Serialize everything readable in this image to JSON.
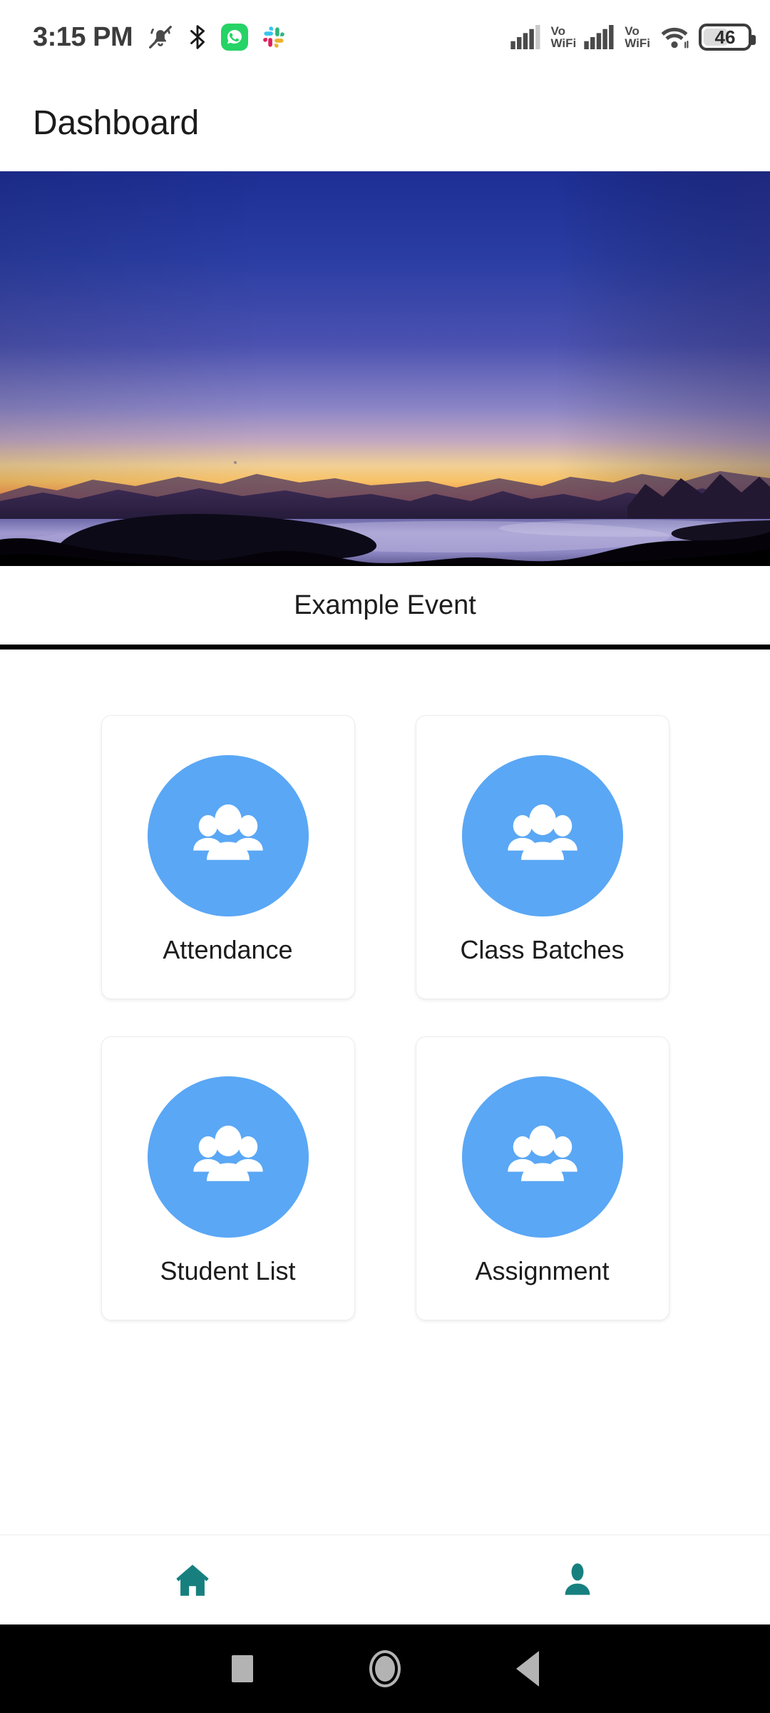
{
  "statusbar": {
    "time": "3:15 PM",
    "icons": [
      "silent-bell-icon",
      "bluetooth-icon",
      "whatsapp-icon",
      "slack-icon"
    ],
    "signal1_label_top": "Vo",
    "signal1_label_bottom": "WiFi",
    "signal2_label_top": "Vo",
    "signal2_label_bottom": "WiFi",
    "wifi": "wifi-icon",
    "battery_percent": "46"
  },
  "appbar": {
    "title": "Dashboard"
  },
  "banner": {
    "alt": "sunset-lake-landscape",
    "sky_top_color": "#1f2f96",
    "sky_mid_color": "#8f8fd0",
    "horizon_glow_color": "#f9c56a",
    "horizon_red_color": "#f2603c",
    "water_color": "#8b85c4",
    "land_color": "#0a0712"
  },
  "event": {
    "caption": "Example Event"
  },
  "tiles": [
    {
      "label": "Attendance",
      "icon": "people-group-icon",
      "circle_color": "#5aa7f5"
    },
    {
      "label": "Class Batches",
      "icon": "people-group-icon",
      "circle_color": "#5aa7f5"
    },
    {
      "label": "Student List",
      "icon": "people-group-icon",
      "circle_color": "#5aa7f5"
    },
    {
      "label": "Assignment",
      "icon": "people-group-icon",
      "circle_color": "#5aa7f5"
    }
  ],
  "bottomnav": {
    "items": [
      {
        "icon": "home-icon",
        "color": "#17807f"
      },
      {
        "icon": "person-icon",
        "color": "#17807f"
      }
    ]
  },
  "androidnav": {
    "buttons": [
      "recents-square-icon",
      "home-circle-icon",
      "back-triangle-icon"
    ]
  },
  "colors": {
    "accent_blue": "#5aa7f5",
    "nav_teal": "#17807f",
    "text_dark": "#1b1b1b"
  }
}
